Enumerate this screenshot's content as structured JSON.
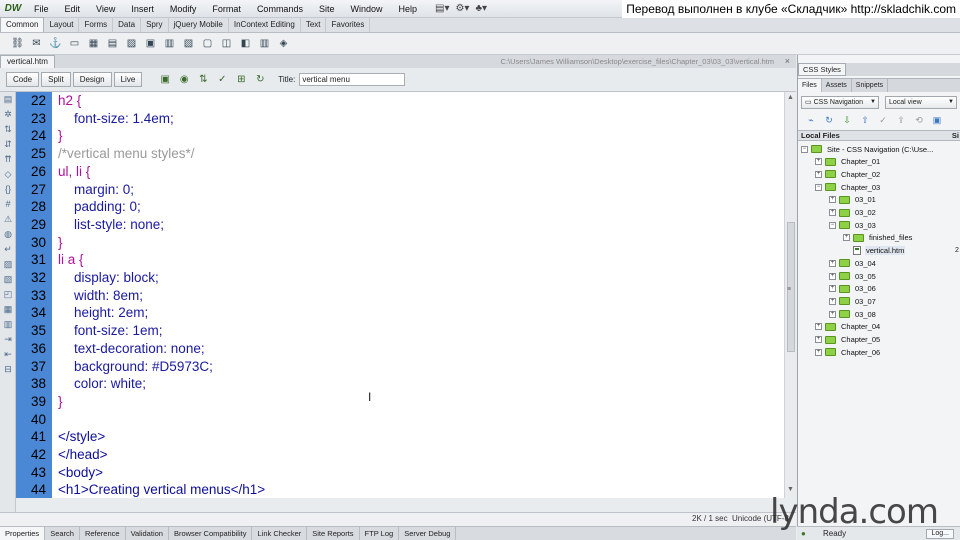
{
  "app": {
    "logo": "DW"
  },
  "menus": [
    "File",
    "Edit",
    "View",
    "Insert",
    "Modify",
    "Format",
    "Commands",
    "Site",
    "Window",
    "Help"
  ],
  "banner": "Перевод выполнен в клубе «Складчик» http://skladchik.com",
  "insert_tabs": [
    "Common",
    "Layout",
    "Forms",
    "Data",
    "Spry",
    "jQuery Mobile",
    "InContext Editing",
    "Text",
    "Favorites"
  ],
  "document": {
    "tab": "vertical.htm",
    "path": "C:\\Users\\James Williamson\\Desktop\\exercise_files\\Chapter_03\\03_03\\vertical.htm",
    "close_glyph": "×",
    "view_buttons": [
      "Code",
      "Split",
      "Design",
      "Live"
    ],
    "title_label": "Title:",
    "title_value": "vertical menu"
  },
  "code_lines": [
    {
      "num": "22",
      "text": "h2 {",
      "kind": "sel",
      "indent": false
    },
    {
      "num": "23",
      "text": "font-size: 1.4em;",
      "kind": "prop",
      "indent": true
    },
    {
      "num": "24",
      "text": "}",
      "kind": "sel",
      "indent": false
    },
    {
      "num": "25",
      "text": "/*vertical menu styles*/",
      "kind": "cmt",
      "indent": false
    },
    {
      "num": "26",
      "text": "ul, li {",
      "kind": "sel",
      "indent": false
    },
    {
      "num": "27",
      "text": "margin: 0;",
      "kind": "prop",
      "indent": true
    },
    {
      "num": "28",
      "text": "padding: 0;",
      "kind": "prop",
      "indent": true
    },
    {
      "num": "29",
      "text": "list-style: none;",
      "kind": "prop",
      "indent": true
    },
    {
      "num": "30",
      "text": "}",
      "kind": "sel",
      "indent": false
    },
    {
      "num": "31",
      "text": "li a {",
      "kind": "sel",
      "indent": false
    },
    {
      "num": "32",
      "text": "display: block;",
      "kind": "prop",
      "indent": true
    },
    {
      "num": "33",
      "text": "width: 8em;",
      "kind": "prop",
      "indent": true
    },
    {
      "num": "34",
      "text": "height: 2em;",
      "kind": "prop",
      "indent": true
    },
    {
      "num": "35",
      "text": "font-size: 1em;",
      "kind": "prop",
      "indent": true
    },
    {
      "num": "36",
      "text": "text-decoration: none;",
      "kind": "prop",
      "indent": true
    },
    {
      "num": "37",
      "text": "background: #D5973C;",
      "kind": "prop",
      "indent": true
    },
    {
      "num": "38",
      "text": "color: white;",
      "kind": "prop",
      "indent": true
    },
    {
      "num": "39",
      "text": "}",
      "kind": "sel",
      "indent": false
    },
    {
      "num": "40",
      "text": "",
      "kind": "text",
      "indent": false
    },
    {
      "num": "41",
      "text": "</style>",
      "kind": "tag",
      "indent": false
    },
    {
      "num": "42",
      "text": "</head>",
      "kind": "tag",
      "indent": false
    },
    {
      "num": "43",
      "text": "<body>",
      "kind": "tag",
      "indent": false
    },
    {
      "num": "44",
      "text": "<h1>Creating vertical menus</h1>",
      "kind": "tag",
      "indent": false
    }
  ],
  "status": {
    "size_time": "2K / 1 sec",
    "encoding": "Unicode (UTF-8"
  },
  "bottom_tabs": [
    "Properties",
    "Search",
    "Reference",
    "Validation",
    "Browser Compatibility",
    "Link Checker",
    "Site Reports",
    "FTP Log",
    "Server Debug"
  ],
  "panel": {
    "css_tab": "CSS Styles",
    "file_tabs": [
      "Files",
      "Assets",
      "Snippets"
    ],
    "site_select": "CSS Navigation",
    "view_select": "Local view",
    "local_files_header": "Local Files",
    "size_header": "Si",
    "tree": [
      {
        "label": "Site - CSS Navigation (C:\\Use...",
        "level": 0,
        "kind": "folder",
        "exp": "−"
      },
      {
        "label": "Chapter_01",
        "level": 1,
        "kind": "folder",
        "exp": "+"
      },
      {
        "label": "Chapter_02",
        "level": 1,
        "kind": "folder",
        "exp": "+"
      },
      {
        "label": "Chapter_03",
        "level": 1,
        "kind": "folder",
        "exp": "−"
      },
      {
        "label": "03_01",
        "level": 2,
        "kind": "folder",
        "exp": "+"
      },
      {
        "label": "03_02",
        "level": 2,
        "kind": "folder",
        "exp": "+"
      },
      {
        "label": "03_03",
        "level": 2,
        "kind": "folder",
        "exp": "−"
      },
      {
        "label": "finished_files",
        "level": 3,
        "kind": "folder",
        "exp": "+"
      },
      {
        "label": "vertical.htm",
        "level": 3,
        "kind": "file",
        "exp": "",
        "side": "2"
      },
      {
        "label": "03_04",
        "level": 2,
        "kind": "folder",
        "exp": "+"
      },
      {
        "label": "03_05",
        "level": 2,
        "kind": "folder",
        "exp": "+"
      },
      {
        "label": "03_06",
        "level": 2,
        "kind": "folder",
        "exp": "+"
      },
      {
        "label": "03_07",
        "level": 2,
        "kind": "folder",
        "exp": "+"
      },
      {
        "label": "03_08",
        "level": 2,
        "kind": "folder",
        "exp": "+"
      },
      {
        "label": "Chapter_04",
        "level": 1,
        "kind": "folder",
        "exp": "+"
      },
      {
        "label": "Chapter_05",
        "level": 1,
        "kind": "folder",
        "exp": "+"
      },
      {
        "label": "Chapter_06",
        "level": 1,
        "kind": "folder",
        "exp": "+"
      }
    ],
    "status_text": "Ready",
    "log_button": "Log..."
  },
  "watermark": "lynda.com",
  "icons": {
    "toolbar": [
      "hyperlink-icon",
      "email-link-icon",
      "named-anchor-icon",
      "horizontal-rule-icon",
      "table-icon",
      "insert-div-icon",
      "images-icon",
      "media-icon",
      "date-icon",
      "server-side-include-icon",
      "comment-icon",
      "head-icon",
      "script-icon",
      "templates-icon",
      "tag-chooser-icon"
    ],
    "doc_toolbar": [
      "multiscreen-icon",
      "preview-browser-icon",
      "file-management-icon",
      "w3c-validation-icon",
      "visual-aids-icon",
      "refresh-icon"
    ],
    "files": [
      "connect-icon",
      "refresh-icon",
      "get-files-icon",
      "put-files-icon",
      "check-out-icon",
      "check-in-icon",
      "sync-icon",
      "expand-icon"
    ]
  }
}
